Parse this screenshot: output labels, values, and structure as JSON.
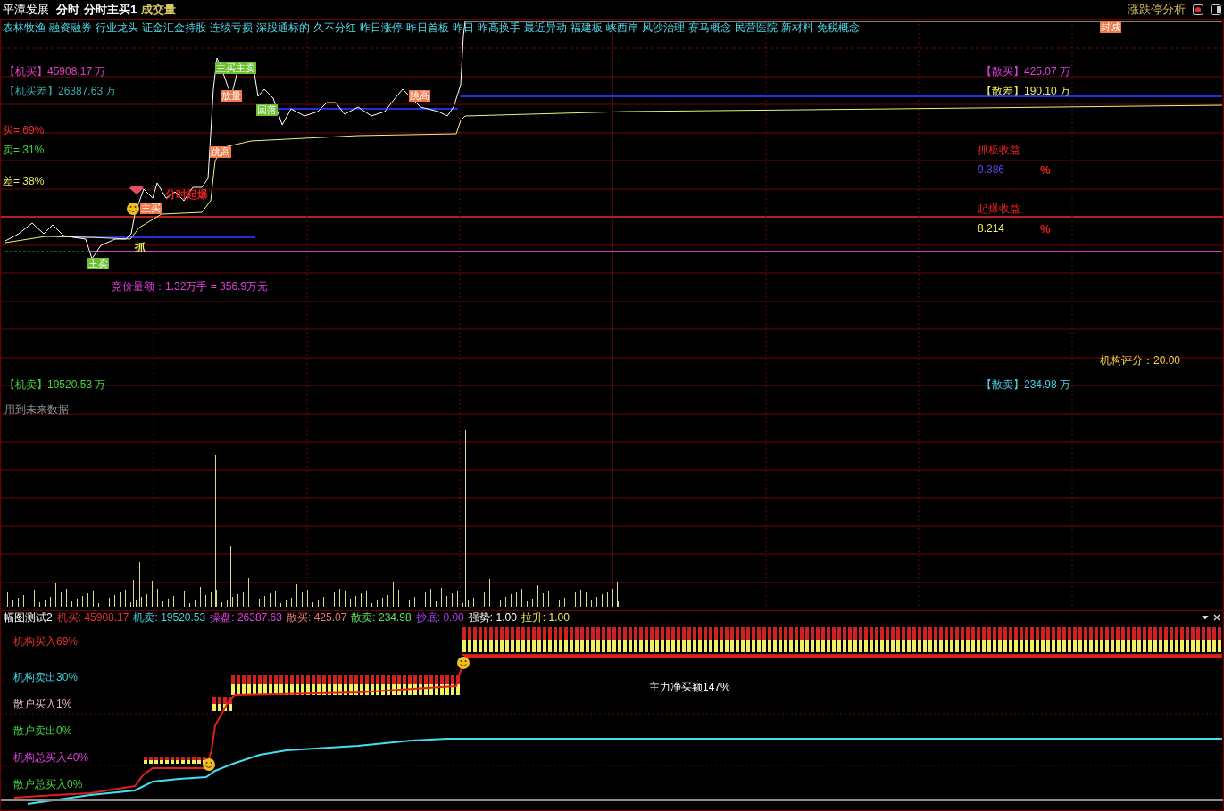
{
  "header": {
    "title": "平潭发展",
    "indicators": [
      {
        "label": "分时",
        "color": "#ffffff"
      },
      {
        "label": "分时主买1",
        "color": "#ffffff"
      },
      {
        "label": "成交量",
        "color": "#d8c860"
      }
    ],
    "panel_title": "涨跌停分析"
  },
  "concepts": [
    "农林牧渔",
    "融资融券",
    "行业龙头",
    "证金汇金持股",
    "连续亏损",
    "深股通标的",
    "久不分红",
    "昨日涨停",
    "昨日首板",
    "昨日",
    "昨高换手",
    "最近异动",
    "福建板",
    "峡西岸",
    "风沙治理",
    "赛马概念",
    "民营医院",
    "新材料",
    "免税概念"
  ],
  "main_chart": {
    "readouts": [
      {
        "text": "【机买】45908.17 万",
        "color": "#e040c0"
      },
      {
        "text": "【机买差】26387.63 万",
        "color": "#3aa8a8"
      },
      {
        "text": "买= 69%",
        "color": "#e03030"
      },
      {
        "text": "卖= 31%",
        "color": "#40d040"
      },
      {
        "text": "差= 38%",
        "color": "#e0e060"
      },
      {
        "text": "竞价量额：1.32万手 = 356.9万元",
        "color": "#e040e0"
      },
      {
        "text": "【机卖】19520.53 万",
        "color": "#40d040"
      },
      {
        "text": "用到未来数据",
        "color": "#909090"
      },
      {
        "text": "【散买】425.07 万",
        "color": "#e040e0"
      },
      {
        "text": "【散差】190.10 万",
        "color": "#f0f060"
      },
      {
        "text": "抓板收益",
        "color": "#e02020"
      },
      {
        "text": "9.386",
        "color": "#6040e0"
      },
      {
        "text": "%",
        "color": "#e02020"
      },
      {
        "text": "起爆收益",
        "color": "#e02020"
      },
      {
        "text": "8.214",
        "color": "#f0f060"
      },
      {
        "text": "%",
        "color": "#e02020"
      },
      {
        "text": "机构评分：20.00",
        "color": "#f0d040"
      },
      {
        "text": "【散卖】234.98 万",
        "color": "#40d0e0"
      }
    ],
    "markers": [
      {
        "text": "主买主卖",
        "kind": "tag",
        "color": "#6cc030"
      },
      {
        "text": "放量",
        "kind": "tag",
        "color": "#f07848"
      },
      {
        "text": "回落",
        "kind": "tag",
        "color": "#6cc030"
      },
      {
        "text": "跳高",
        "kind": "tag",
        "color": "#f07848"
      },
      {
        "text": "跳高",
        "kind": "tag",
        "color": "#f07848"
      },
      {
        "text": "封减",
        "kind": "tag",
        "color": "#f07848"
      },
      {
        "text": "分时起爆",
        "kind": "text",
        "color": "#e02020"
      },
      {
        "text": "主买",
        "kind": "tag",
        "color": "#f07848"
      },
      {
        "text": "抓",
        "kind": "text",
        "color": "#f0f060"
      },
      {
        "text": "主卖",
        "kind": "tag",
        "color": "#6cc030"
      }
    ]
  },
  "sub_chart": {
    "title": "幅图测试2",
    "stats": [
      {
        "label": "机买:",
        "value": "45908.17",
        "color": "#e03030"
      },
      {
        "label": "机卖:",
        "value": "19520.53",
        "color": "#40d0e0"
      },
      {
        "label": "操盘:",
        "value": "26387.63",
        "color": "#e040e0"
      },
      {
        "label": "散买:",
        "value": "425.07",
        "color": "#e87878"
      },
      {
        "label": "散卖:",
        "value": "234.98",
        "color": "#60e060"
      },
      {
        "label": "抄底:",
        "value": "0.00",
        "color": "#b040f0"
      },
      {
        "label": "强势:",
        "value": "1.00",
        "color": "#ffffff"
      },
      {
        "label": "拉升:",
        "value": "1.00",
        "color": "#f0f060"
      }
    ],
    "legend": [
      {
        "text": "机构买入69%",
        "color": "#e03030"
      },
      {
        "text": "机构卖出30%",
        "color": "#40d0e0"
      },
      {
        "text": "散户买入1%",
        "color": "#e8b8b8"
      },
      {
        "text": "散户卖出0%",
        "color": "#40d040"
      },
      {
        "text": "机构总买入40%",
        "color": "#e040e0"
      },
      {
        "text": "散户总买入0%",
        "color": "#40d040"
      }
    ],
    "note": "主力净买额147%"
  }
}
